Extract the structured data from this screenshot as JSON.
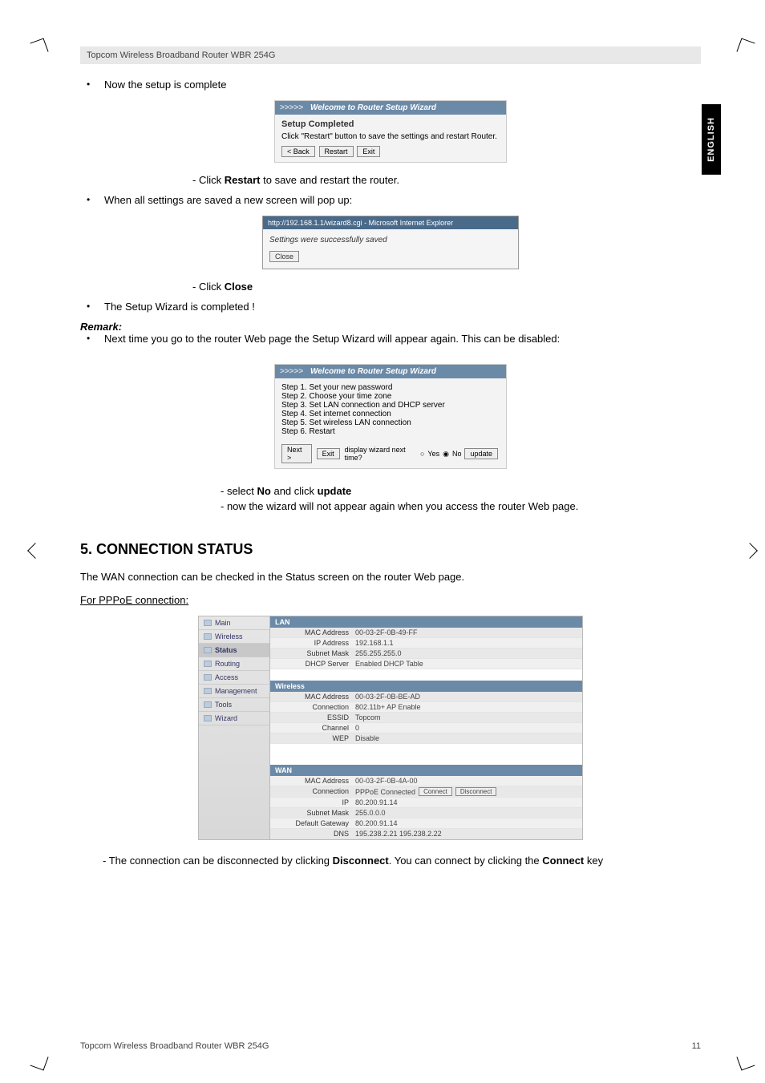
{
  "header": {
    "product": "Topcom Wireless Broadband Router WBR 254G"
  },
  "langTab": "ENGLISH",
  "lines": {
    "nowComplete": "Now the setup is complete",
    "clickRestart_pre": "- Click ",
    "clickRestart_b": "Restart",
    "clickRestart_post": " to save and restart the router.",
    "whenSaved": "When all settings are saved a new screen will pop up:",
    "clickClose_pre": "- Click ",
    "clickClose_b": "Close",
    "wizardCompleted": "The Setup Wizard is completed !",
    "remark": "Remark:",
    "nextTime": "Next time you go to the router Web page the Setup Wizard will appear again. This can be disabled:",
    "selectNo_pre": "- select ",
    "selectNo_b1": "No",
    "selectNo_mid": " and click ",
    "selectNo_b2": "update",
    "nowWizard": "- now the wizard will not appear again when you access the router Web page.",
    "section5": "5.  CONNECTION STATUS",
    "wanChecked": "The WAN connection can be checked in the Status screen on the router Web page.",
    "forPPPoE": "For PPPoE connection:",
    "disconnect_pre": "- The connection can be disconnected by clicking ",
    "disconnect_b1": "Disconnect",
    "disconnect_mid": ". You can connect by clicking the ",
    "disconnect_b2": "Connect",
    "disconnect_post": " key"
  },
  "wizard1": {
    "titlePrefix": ">>>>>",
    "title": "Welcome to Router Setup Wizard",
    "heading": "Setup Completed",
    "msg": "Click \"Restart\" button to save the settings and restart Router.",
    "btnBack": "< Back",
    "btnRestart": "Restart",
    "btnExit": "Exit"
  },
  "ieDialog": {
    "title": "http://192.168.1.1/wizard8.cgi - Microsoft Internet Explorer",
    "msg": "Settings were successfully saved",
    "btn": "Close"
  },
  "wizard2": {
    "titlePrefix": ">>>>>",
    "title": "Welcome to Router Setup Wizard",
    "steps": [
      "Step 1. Set your new password",
      "Step 2. Choose your time zone",
      "Step 3. Set LAN connection and DHCP server",
      "Step 4. Set internet connection",
      "Step 5. Set wireless LAN connection",
      "Step 6. Restart"
    ],
    "btnNext": "Next >",
    "btnExit": "Exit",
    "displayText": "display wizard next time?",
    "yes": "Yes",
    "no": "No",
    "btnUpdate": "update"
  },
  "status": {
    "sidebar": [
      "Main",
      "Wireless",
      "Status",
      "Routing",
      "Access",
      "Management",
      "Tools",
      "Wizard"
    ],
    "lan": {
      "title": "LAN",
      "rows": [
        [
          "MAC Address",
          "00-03-2F-0B-49-FF"
        ],
        [
          "IP Address",
          "192.168.1.1"
        ],
        [
          "Subnet Mask",
          "255.255.255.0"
        ],
        [
          "DHCP Server",
          "Enabled   DHCP Table"
        ]
      ]
    },
    "wireless": {
      "title": "Wireless",
      "rows": [
        [
          "MAC Address",
          "00-03-2F-0B-BE-AD"
        ],
        [
          "Connection",
          "802.11b+ AP Enable"
        ],
        [
          "ESSID",
          "Topcom"
        ],
        [
          "Channel",
          "0"
        ],
        [
          "WEP",
          "Disable"
        ]
      ]
    },
    "wan": {
      "title": "WAN",
      "rows": [
        [
          "MAC Address",
          "00-03-2F-0B-4A-00"
        ],
        [
          "Connection",
          "PPPoE Connected"
        ],
        [
          "IP",
          "80.200.91.14"
        ],
        [
          "Subnet Mask",
          "255.0.0.0"
        ],
        [
          "Default Gateway",
          "80.200.91.14"
        ],
        [
          "DNS",
          "195.238.2.21 195.238.2.22"
        ]
      ],
      "btnConnect": "Connect",
      "btnDisconnect": "Disconnect"
    }
  },
  "footer": {
    "left": "Topcom Wireless Broadband Router WBR 254G",
    "right": "11"
  }
}
